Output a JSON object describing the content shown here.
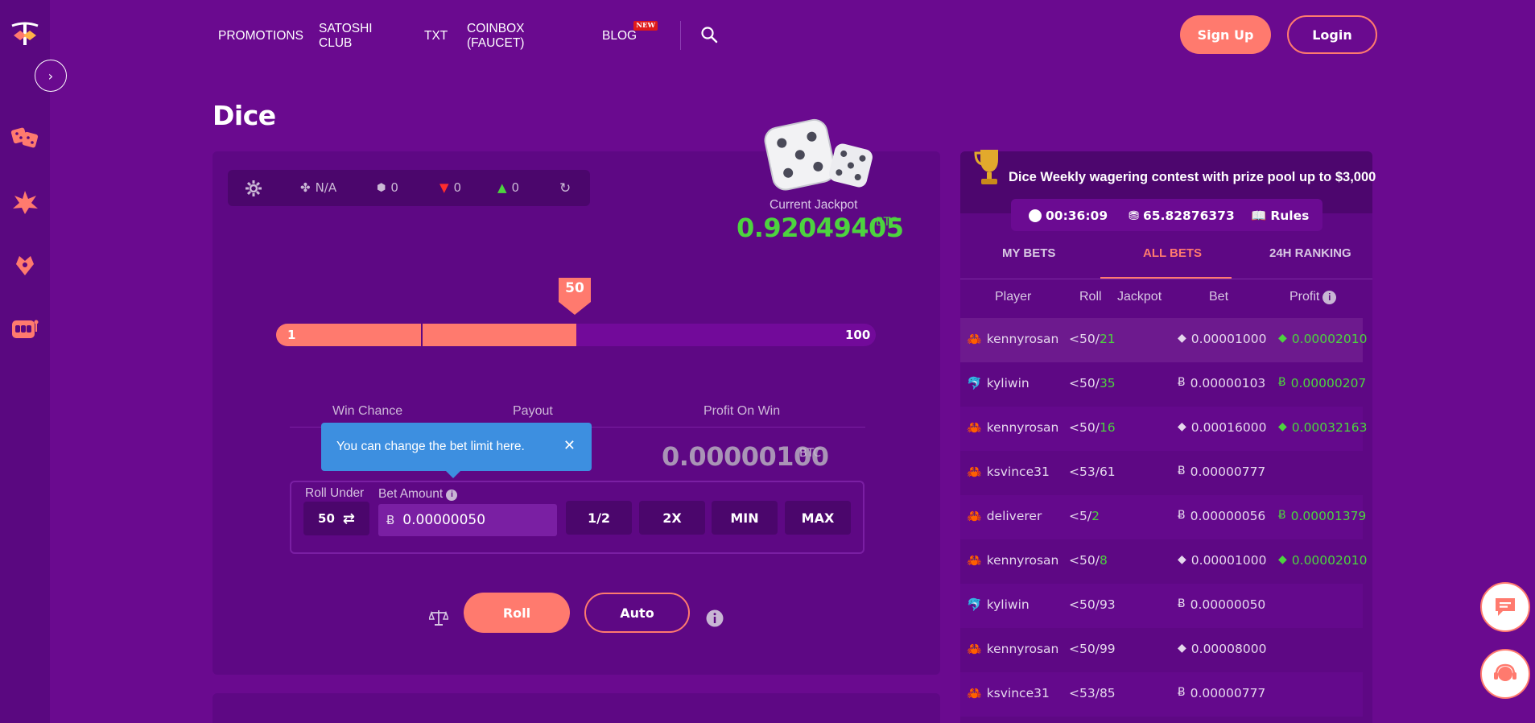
{
  "colors": {
    "background": "#6a0a8f",
    "panel": "#5e0884",
    "accent": "#ff7a6e",
    "green": "#4dd33f",
    "tooltip": "#3d8fe0"
  },
  "nav": {
    "items": [
      "PROMOTIONS",
      "SATOSHI CLUB",
      "TXT",
      "COINBOX (FAUCET)",
      "BLOG"
    ],
    "new_badge": "NEW",
    "signup": "Sign Up",
    "login": "Login"
  },
  "page": {
    "title": "Dice"
  },
  "toolbar": {
    "luck": "N/A",
    "bets": "0",
    "losses": "0",
    "wins": "0"
  },
  "jackpot": {
    "label": "Current Jackpot",
    "value": "0.92049405",
    "unit": "BTC"
  },
  "slider": {
    "min": "1",
    "max": "100",
    "value": "50",
    "value_fraction": 0.5
  },
  "stats": {
    "win_chance_label": "Win Chance",
    "payout_label": "Payout",
    "profit_label": "Profit On Win",
    "profit_value": "0.00000100",
    "profit_unit": "BTC"
  },
  "tooltip": {
    "text": "You can change the bet limit here.",
    "close": "✕"
  },
  "bet": {
    "roll_under_label": "Roll Under",
    "roll_under_value": "50",
    "amount_label": "Bet Amount",
    "amount_value": "0.00000050",
    "half": "1/2",
    "double": "2X",
    "min": "MIN",
    "max": "MAX",
    "roll": "Roll",
    "auto": "Auto"
  },
  "contest": {
    "title": "Dice Weekly wagering contest with prize pool up to $3,000",
    "timer": "00:36:09",
    "pool": "65.82876373",
    "rules": "Rules"
  },
  "tabs": [
    "MY BETS",
    "ALL BETS",
    "24H RANKING"
  ],
  "table": {
    "headers": [
      "Player",
      "Roll",
      "Jackpot",
      "Bet",
      "Profit"
    ],
    "rows": [
      {
        "avatar": "crab",
        "player": "kennyrosan",
        "roll_target": "<50/",
        "roll_result": "21",
        "win": true,
        "coin": "eth",
        "bet": "0.00001000",
        "profit": "0.00002010"
      },
      {
        "avatar": "dolphin",
        "player": "kyliwin",
        "roll_target": "<50/",
        "roll_result": "35",
        "win": true,
        "coin": "btc",
        "bet": "0.00000103",
        "profit": "0.00000207"
      },
      {
        "avatar": "crab",
        "player": "kennyrosan",
        "roll_target": "<50/",
        "roll_result": "16",
        "win": true,
        "coin": "eth",
        "bet": "0.00016000",
        "profit": "0.00032163"
      },
      {
        "avatar": "crab",
        "player": "ksvince31",
        "roll_target": "<53/",
        "roll_result": "61",
        "win": false,
        "coin": "btc",
        "bet": "0.00000777",
        "profit": ""
      },
      {
        "avatar": "crab",
        "player": "deliverer",
        "roll_target": "<5/",
        "roll_result": "2",
        "win": true,
        "coin": "btc",
        "bet": "0.00000056",
        "profit": "0.00001379"
      },
      {
        "avatar": "crab",
        "player": "kennyrosan",
        "roll_target": "<50/",
        "roll_result": "8",
        "win": true,
        "coin": "eth",
        "bet": "0.00001000",
        "profit": "0.00002010"
      },
      {
        "avatar": "dolphin",
        "player": "kyliwin",
        "roll_target": "<50/",
        "roll_result": "93",
        "win": false,
        "coin": "btc",
        "bet": "0.00000050",
        "profit": ""
      },
      {
        "avatar": "crab",
        "player": "kennyrosan",
        "roll_target": "<50/",
        "roll_result": "99",
        "win": false,
        "coin": "eth",
        "bet": "0.00008000",
        "profit": ""
      },
      {
        "avatar": "crab",
        "player": "ksvince31",
        "roll_target": "<53/",
        "roll_result": "85",
        "win": false,
        "coin": "btc",
        "bet": "0.00000777",
        "profit": ""
      }
    ]
  }
}
